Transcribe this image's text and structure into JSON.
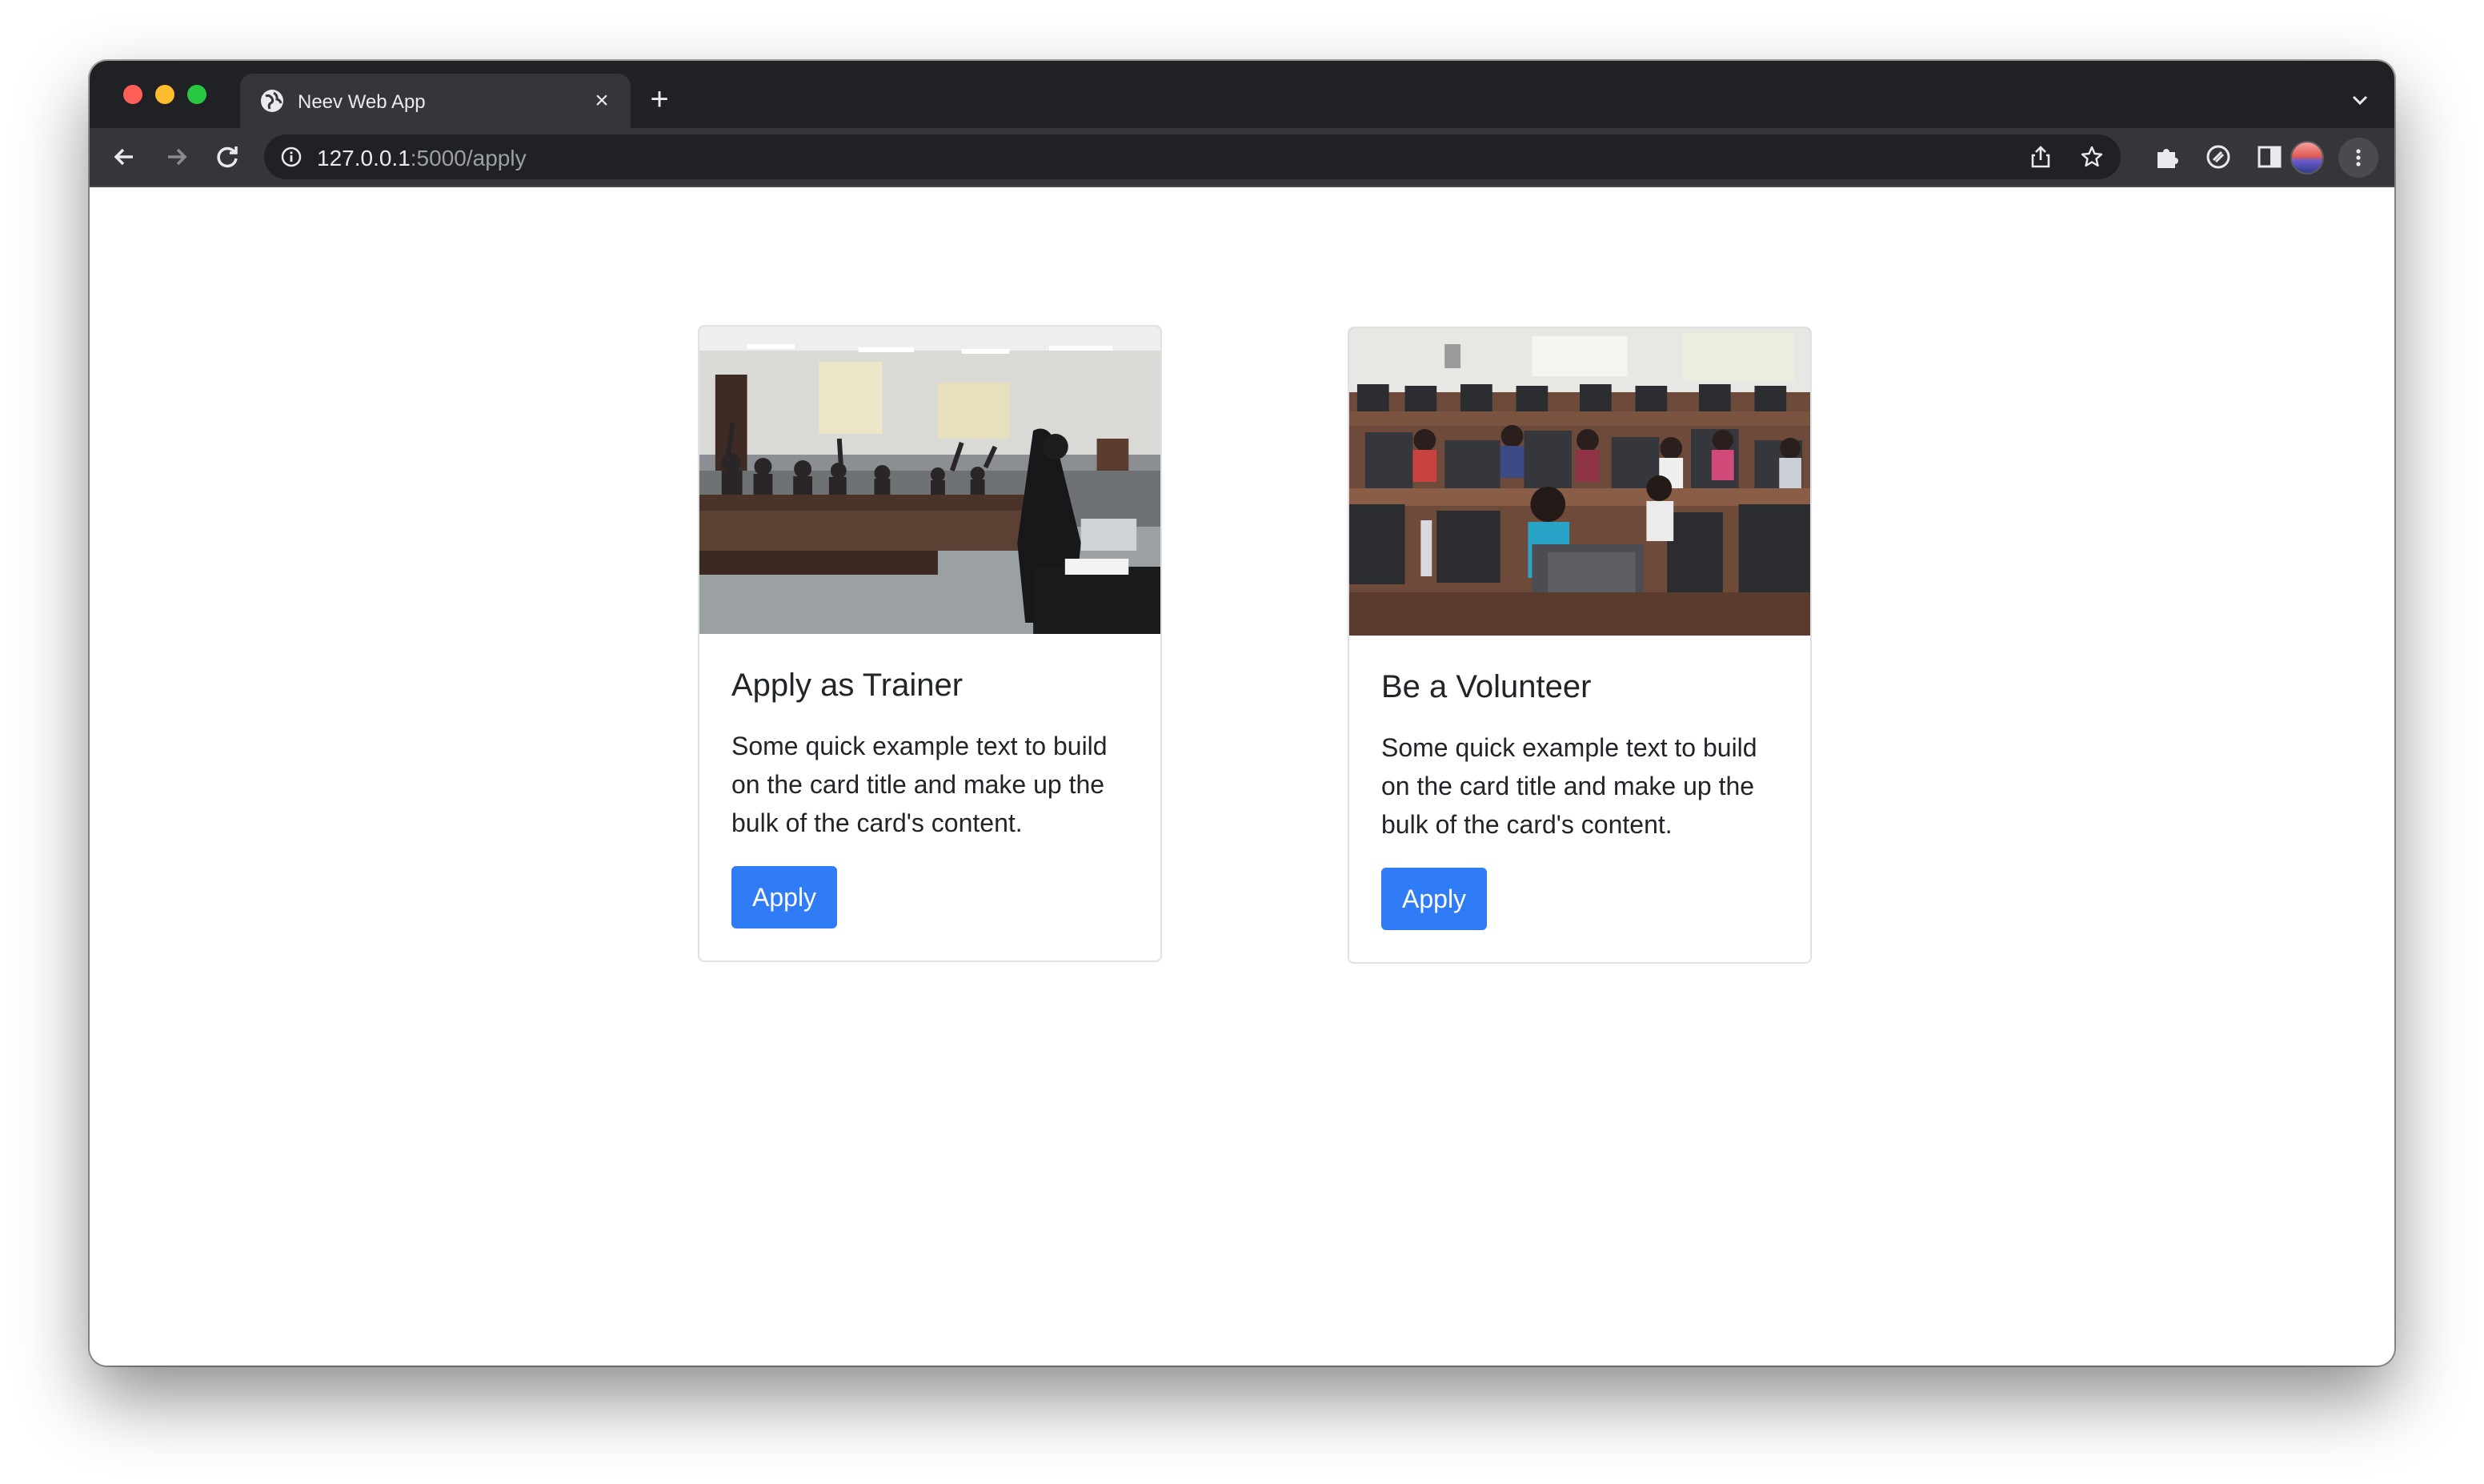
{
  "browser": {
    "tab_title": "Neev Web App",
    "tab_close": "×",
    "new_tab": "+",
    "url_host": "127.0.0.1",
    "url_path": ":5000/apply",
    "icons": [
      "globe-icon",
      "close-icon",
      "plus-icon",
      "chevron-down-icon",
      "back-arrow-icon",
      "forward-arrow-icon",
      "reload-icon",
      "info-icon",
      "share-icon",
      "star-icon",
      "puzzle-icon",
      "extension-icon",
      "side-panel-icon",
      "profile-avatar",
      "kebab-menu-icon"
    ]
  },
  "cards": [
    {
      "title": "Apply as Trainer",
      "text": "Some quick example text to build on the card title and make up the bulk of the card's content.",
      "button": "Apply"
    },
    {
      "title": "Be a Volunteer",
      "text": "Some quick example text to build on the card title and make up the bulk of the card's content.",
      "button": "Apply"
    }
  ],
  "colors": {
    "primary_button": "#2f7cf6",
    "tab_strip": "#202124",
    "toolbar": "#35363a"
  }
}
